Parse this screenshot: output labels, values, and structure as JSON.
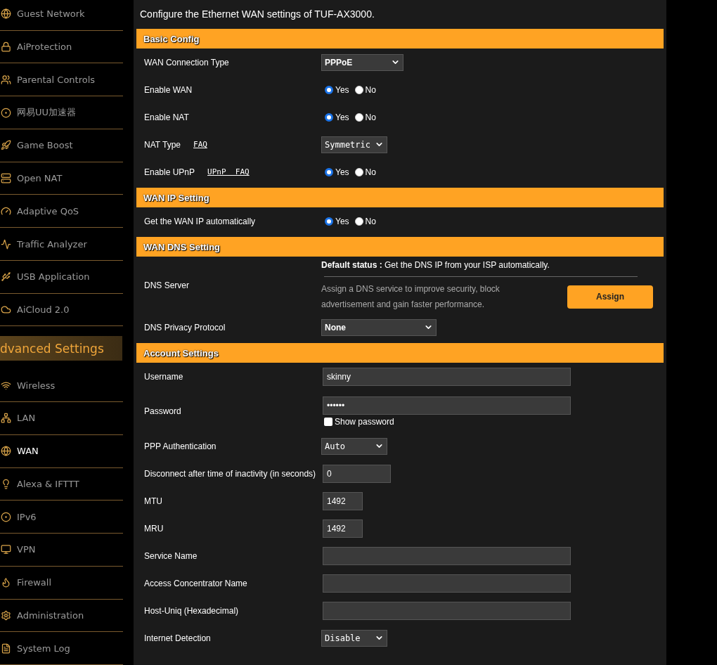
{
  "sidebar": {
    "items": [
      {
        "label": "Guest Network",
        "selected": false
      },
      {
        "label": "AiProtection",
        "selected": false
      },
      {
        "label": "Parental Controls",
        "selected": false
      },
      {
        "label": "网易UU加速器",
        "selected": false
      },
      {
        "label": "Game Boost",
        "selected": false
      },
      {
        "label": "Open NAT",
        "selected": false
      },
      {
        "label": "Adaptive QoS",
        "selected": false
      },
      {
        "label": "Traffic Analyzer",
        "selected": false
      },
      {
        "label": "USB Application",
        "selected": false
      },
      {
        "label": "AiCloud 2.0",
        "selected": false
      }
    ],
    "section_title": "dvanced Settings",
    "advanced_items": [
      {
        "label": "Wireless",
        "selected": false
      },
      {
        "label": "LAN",
        "selected": false
      },
      {
        "label": "WAN",
        "selected": true
      },
      {
        "label": "Alexa & IFTTT",
        "selected": false
      },
      {
        "label": "IPv6",
        "selected": false
      },
      {
        "label": "VPN",
        "selected": false
      },
      {
        "label": "Firewall",
        "selected": false
      },
      {
        "label": "Administration",
        "selected": false
      },
      {
        "label": "System Log",
        "selected": false
      }
    ]
  },
  "intro": "Configure the Ethernet WAN settings of TUF-AX3000.",
  "sections": [
    {
      "title": "Basic Config",
      "rows": [
        {
          "kind": "select",
          "label": "WAN Connection Type",
          "value": "PPPoE"
        },
        {
          "kind": "radio",
          "label": "Enable WAN",
          "options": [
            {
              "label": "Yes",
              "selected": true
            },
            {
              "label": "No",
              "selected": false
            }
          ]
        },
        {
          "kind": "radio",
          "label": "Enable NAT",
          "options": [
            {
              "label": "Yes",
              "selected": true
            },
            {
              "label": "No",
              "selected": false
            }
          ]
        },
        {
          "kind": "select",
          "label": "NAT Type",
          "link": "FAQ",
          "value": "Symmetric"
        },
        {
          "kind": "radio",
          "label": "Enable UPnP",
          "link": "UPnP  FAQ",
          "options": [
            {
              "label": "Yes",
              "selected": true
            },
            {
              "label": "No",
              "selected": false
            }
          ]
        }
      ]
    },
    {
      "title": "WAN IP Setting",
      "rows": [
        {
          "kind": "radio",
          "label": "Get the WAN IP automatically",
          "options": [
            {
              "label": "Yes",
              "selected": true
            },
            {
              "label": "No",
              "selected": false
            }
          ]
        }
      ]
    },
    {
      "title": "WAN DNS Setting",
      "rows": [
        {
          "kind": "dns",
          "label": "DNS Server",
          "status_label": "Default status :",
          "status_text": "Get the DNS IP from your ISP automatically.",
          "description": "Assign a DNS service to improve security, block advertisement and gain faster performance.",
          "button": "Assign"
        },
        {
          "kind": "select",
          "label": "DNS Privacy Protocol",
          "value": "None"
        }
      ]
    },
    {
      "title": "Account Settings",
      "rows": [
        {
          "kind": "text",
          "label": "Username",
          "value": "skinny"
        },
        {
          "kind": "password",
          "label": "Password",
          "value": "••••••",
          "show_password": {
            "label": "Show password",
            "checked": false
          }
        },
        {
          "kind": "select",
          "label": "PPP Authentication",
          "value": "Auto"
        },
        {
          "kind": "text",
          "label": "Disconnect after time of inactivity (in seconds)",
          "value": "0"
        },
        {
          "kind": "text",
          "label": "MTU",
          "value": "1492"
        },
        {
          "kind": "text",
          "label": "MRU",
          "value": "1492"
        },
        {
          "kind": "text",
          "label": "Service Name"
        },
        {
          "kind": "text",
          "label": "Access Concentrator Name"
        },
        {
          "kind": "text",
          "label": "Host-Uniq (Hexadecimal)"
        },
        {
          "kind": "select",
          "label": "Internet Detection",
          "value": "Disable"
        }
      ]
    }
  ]
}
